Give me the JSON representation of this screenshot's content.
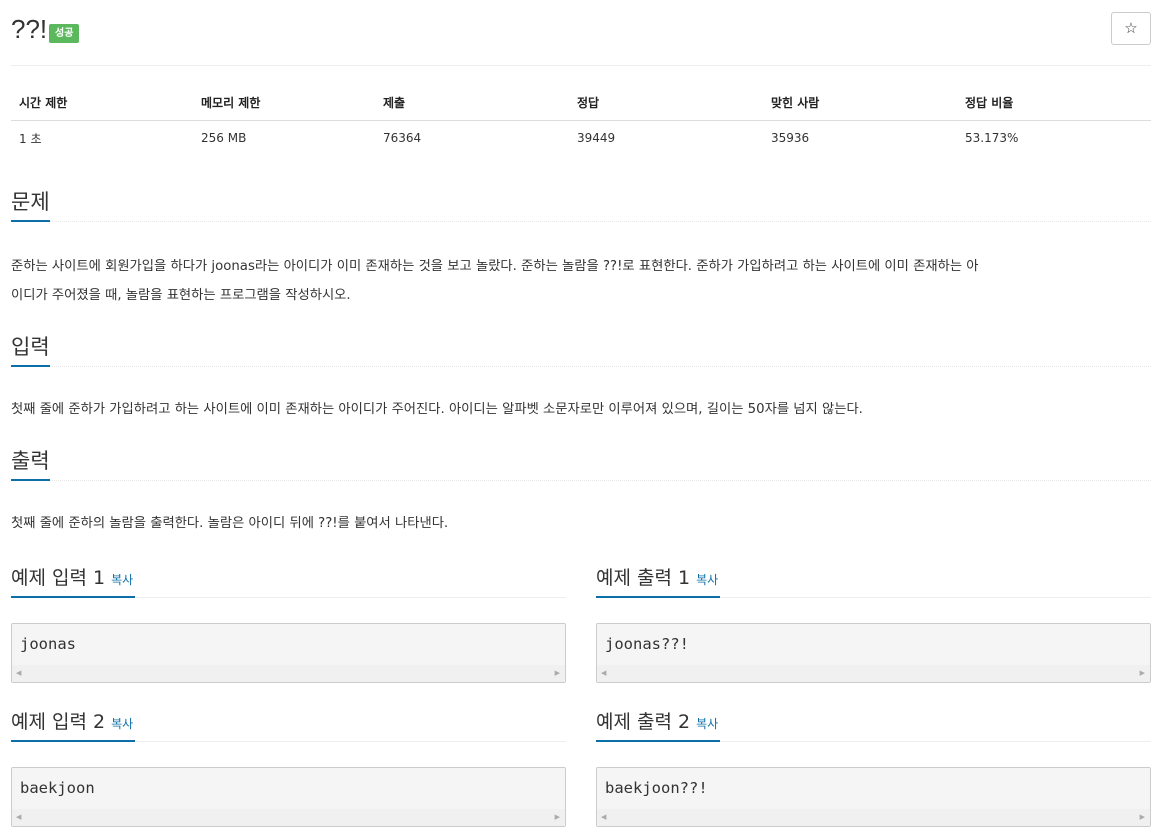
{
  "problem": {
    "title": "??!",
    "badge": "성공"
  },
  "star_icon": "☆",
  "info_table": {
    "headers": [
      "시간 제한",
      "메모리 제한",
      "제출",
      "정답",
      "맞힌 사람",
      "정답 비율"
    ],
    "values": [
      "1 초",
      "256 MB",
      "76364",
      "39449",
      "35936",
      "53.173%"
    ]
  },
  "sections": {
    "description": {
      "heading": "문제",
      "line1": "준하는 사이트에 회원가입을 하다가 joonas라는 아이디가 이미 존재하는 것을 보고 놀랐다. 준하는 놀람을 ??!로 표현한다. 준하가 가입하려고 하는 사이트에 이미 존재하는 아",
      "line2": "이디가 주어졌을 때, 놀람을 표현하는 프로그램을 작성하시오."
    },
    "input": {
      "heading": "입력",
      "text": "첫째 줄에 준하가 가입하려고 하는 사이트에 이미 존재하는 아이디가 주어진다. 아이디는 알파벳 소문자로만 이루어져 있으며, 길이는 50자를 넘지 않는다."
    },
    "output": {
      "heading": "출력",
      "text": "첫째 줄에 준하의 놀람을 출력한다. 놀람은 아이디 뒤에 ??!를 붙여서 나타낸다."
    }
  },
  "examples": {
    "copy_label": "복사",
    "input1": {
      "title": "예제 입력 1",
      "content": "joonas"
    },
    "output1": {
      "title": "예제 출력 1",
      "content": "joonas??!"
    },
    "input2": {
      "title": "예제 입력 2",
      "content": "baekjoon"
    },
    "output2": {
      "title": "예제 출력 2",
      "content": "baekjoon??!"
    }
  },
  "colors": {
    "accent": "#0d6fa8",
    "success": "#5cb85c"
  }
}
